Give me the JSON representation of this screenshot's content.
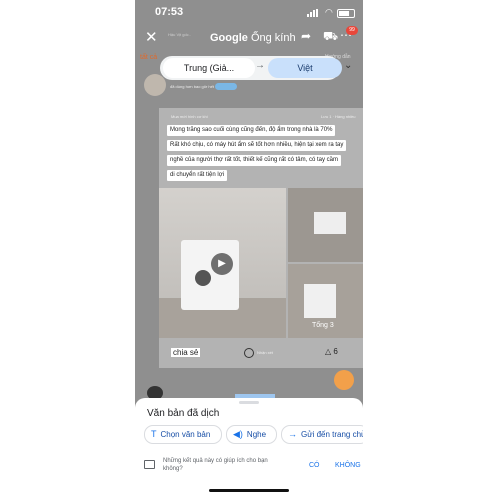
{
  "status_bar": {
    "time": "07:53"
  },
  "header": {
    "title_brand": "Google",
    "title_rest": "Ống kính",
    "overlay_label": "Hậu Vịt gốc..",
    "notification_count": "99",
    "tab_all": "tất cả",
    "tab_right": "Hướng dẫn"
  },
  "language_bar": {
    "source": "Trung (Giả...",
    "target": "Việt"
  },
  "user": {
    "line": "đã dùng hơn bao giờ hết"
  },
  "card": {
    "header_left": "Mua mới hình cơ khí",
    "header_right": "Lưu 1 · Hàng nhiều",
    "lines": [
      "Mong trăng sao cuối cùng cũng đến, độ ẩm trong nhà là 70%",
      "Rất khó chịu, có máy hút ẩm sẽ tốt hơn nhiều, hiện tại xem ra tay",
      "nghề của người thợ rất tốt, thiết kế cũng rất có tâm, có tay cầm",
      "di chuyển rất tiện lợi"
    ],
    "photo_count": "Tổng 3",
    "share": "chia sẻ",
    "comment": "Nhận xét",
    "likes": "6"
  },
  "sheet": {
    "title": "Văn bản đã dịch",
    "chips": [
      "Chọn văn bản",
      "Nghe",
      "Gửi đến trang chủ"
    ],
    "feedback": "Những kết quả này có giúp ích cho bạn không?",
    "yes": "CÓ",
    "no": "KHÔNG"
  },
  "colors": {
    "accent": "#1a73e8",
    "target_lang_bg": "#c9e0fb",
    "tab_all": "#e06a2c"
  },
  "icons": [
    "close-icon",
    "share-icon",
    "cart-icon",
    "more-icon",
    "swap-arrow-icon",
    "chevron-down-icon",
    "play-icon",
    "text-select-icon",
    "speaker-icon",
    "send-icon",
    "feedback-icon"
  ]
}
